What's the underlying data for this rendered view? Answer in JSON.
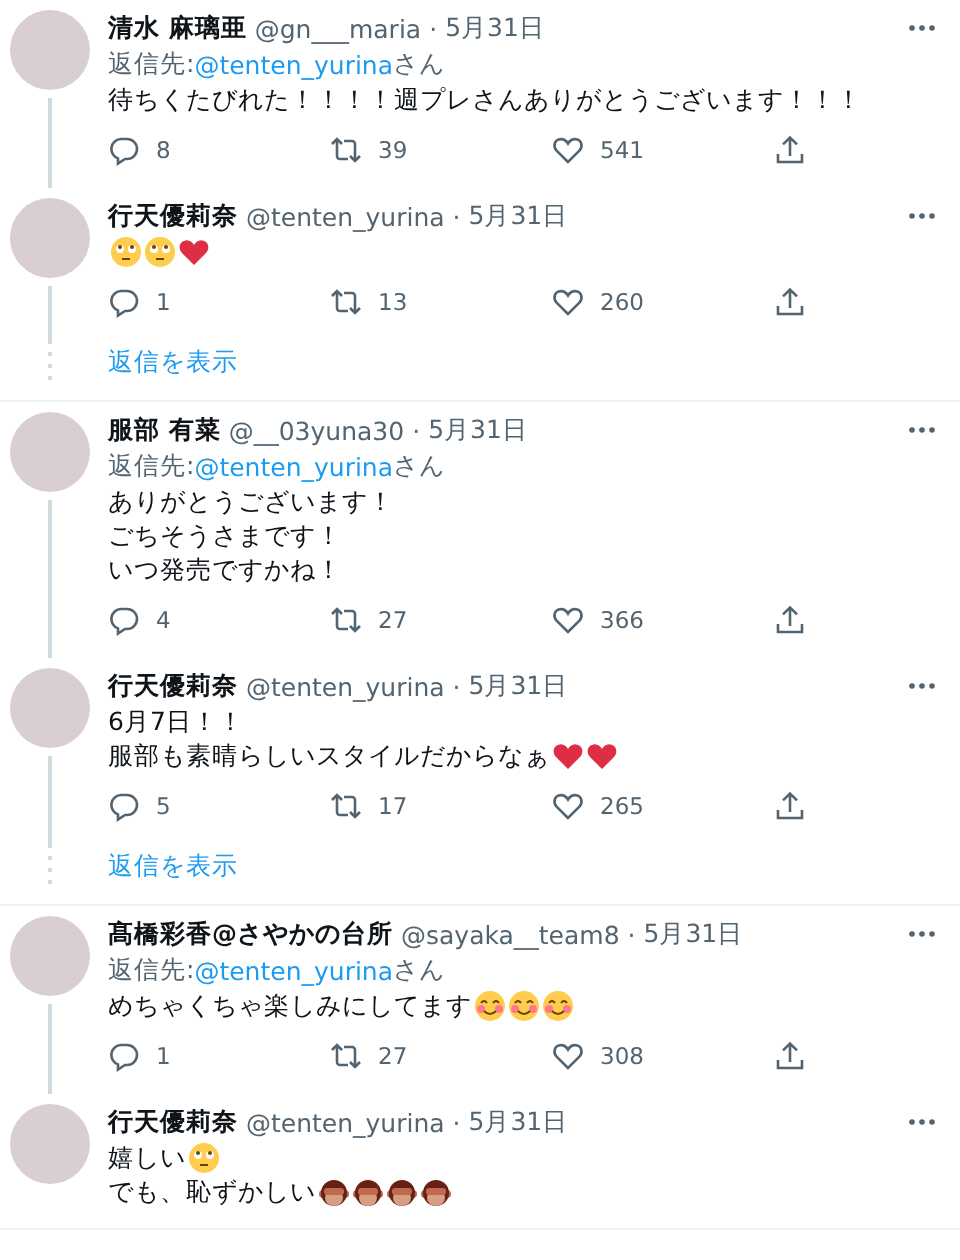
{
  "threads": [
    {
      "tweets": [
        {
          "name": "清水 麻璃亜",
          "handle": "@gn___maria",
          "separator": "·",
          "date": "5月31日",
          "reply_to": {
            "label": "返信先:",
            "handle": "@tenten_yurina",
            "suffix": "さん"
          },
          "lines": [
            {
              "text": "待ちくたびれた！！！！週プレさんありがとうございます！！！"
            }
          ],
          "replies": "8",
          "retweets": "39",
          "likes": "541"
        },
        {
          "name": "行天優莉奈",
          "handle": "@tenten_yurina",
          "separator": "·",
          "date": "5月31日",
          "lines": [
            {
              "emoji": [
                {
                  "kind": "rolling-eyes"
                },
                {
                  "kind": "rolling-eyes"
                },
                {
                  "kind": "heart"
                }
              ]
            }
          ],
          "replies": "1",
          "retweets": "13",
          "likes": "260"
        }
      ],
      "show_replies": "返信を表示"
    },
    {
      "tweets": [
        {
          "name": "服部 有菜",
          "handle": "@__03yuna30",
          "separator": "·",
          "date": "5月31日",
          "reply_to": {
            "label": "返信先:",
            "handle": "@tenten_yurina",
            "suffix": "さん"
          },
          "lines": [
            {
              "text": "ありがとうございます！"
            },
            {
              "text": "ごちそうさまです！"
            },
            {
              "text": "いつ発売ですかね！"
            }
          ],
          "replies": "4",
          "retweets": "27",
          "likes": "366"
        },
        {
          "name": "行天優莉奈",
          "handle": "@tenten_yurina",
          "separator": "·",
          "date": "5月31日",
          "lines": [
            {
              "text": "6月7日！！"
            },
            {
              "text": "服部も素晴らしいスタイルだからなぁ",
              "emoji": [
                {
                  "kind": "heart"
                },
                {
                  "kind": "heart"
                }
              ]
            }
          ],
          "replies": "5",
          "retweets": "17",
          "likes": "265"
        }
      ],
      "show_replies": "返信を表示"
    },
    {
      "tweets": [
        {
          "name": "髙橋彩香@さやかの台所",
          "handle": "@sayaka__team8",
          "separator": "·",
          "date": "5月31日",
          "reply_to": {
            "label": "返信先:",
            "handle": "@tenten_yurina",
            "suffix": "さん"
          },
          "lines": [
            {
              "text": "めちゃくちゃ楽しみにしてます",
              "emoji": [
                {
                  "kind": "smiling"
                },
                {
                  "kind": "smiling"
                },
                {
                  "kind": "smiling"
                }
              ]
            }
          ],
          "replies": "1",
          "retweets": "27",
          "likes": "308"
        },
        {
          "name": "行天優莉奈",
          "handle": "@tenten_yurina",
          "separator": "·",
          "date": "5月31日",
          "lines": [
            {
              "text": "嬉しい",
              "emoji": [
                {
                  "kind": "rolling-eyes"
                }
              ]
            },
            {
              "text": "でも、恥ずかしい",
              "emoji": [
                {
                  "kind": "monkey"
                },
                {
                  "kind": "monkey"
                },
                {
                  "kind": "monkey"
                },
                {
                  "kind": "monkey"
                }
              ]
            }
          ]
        }
      ]
    }
  ]
}
